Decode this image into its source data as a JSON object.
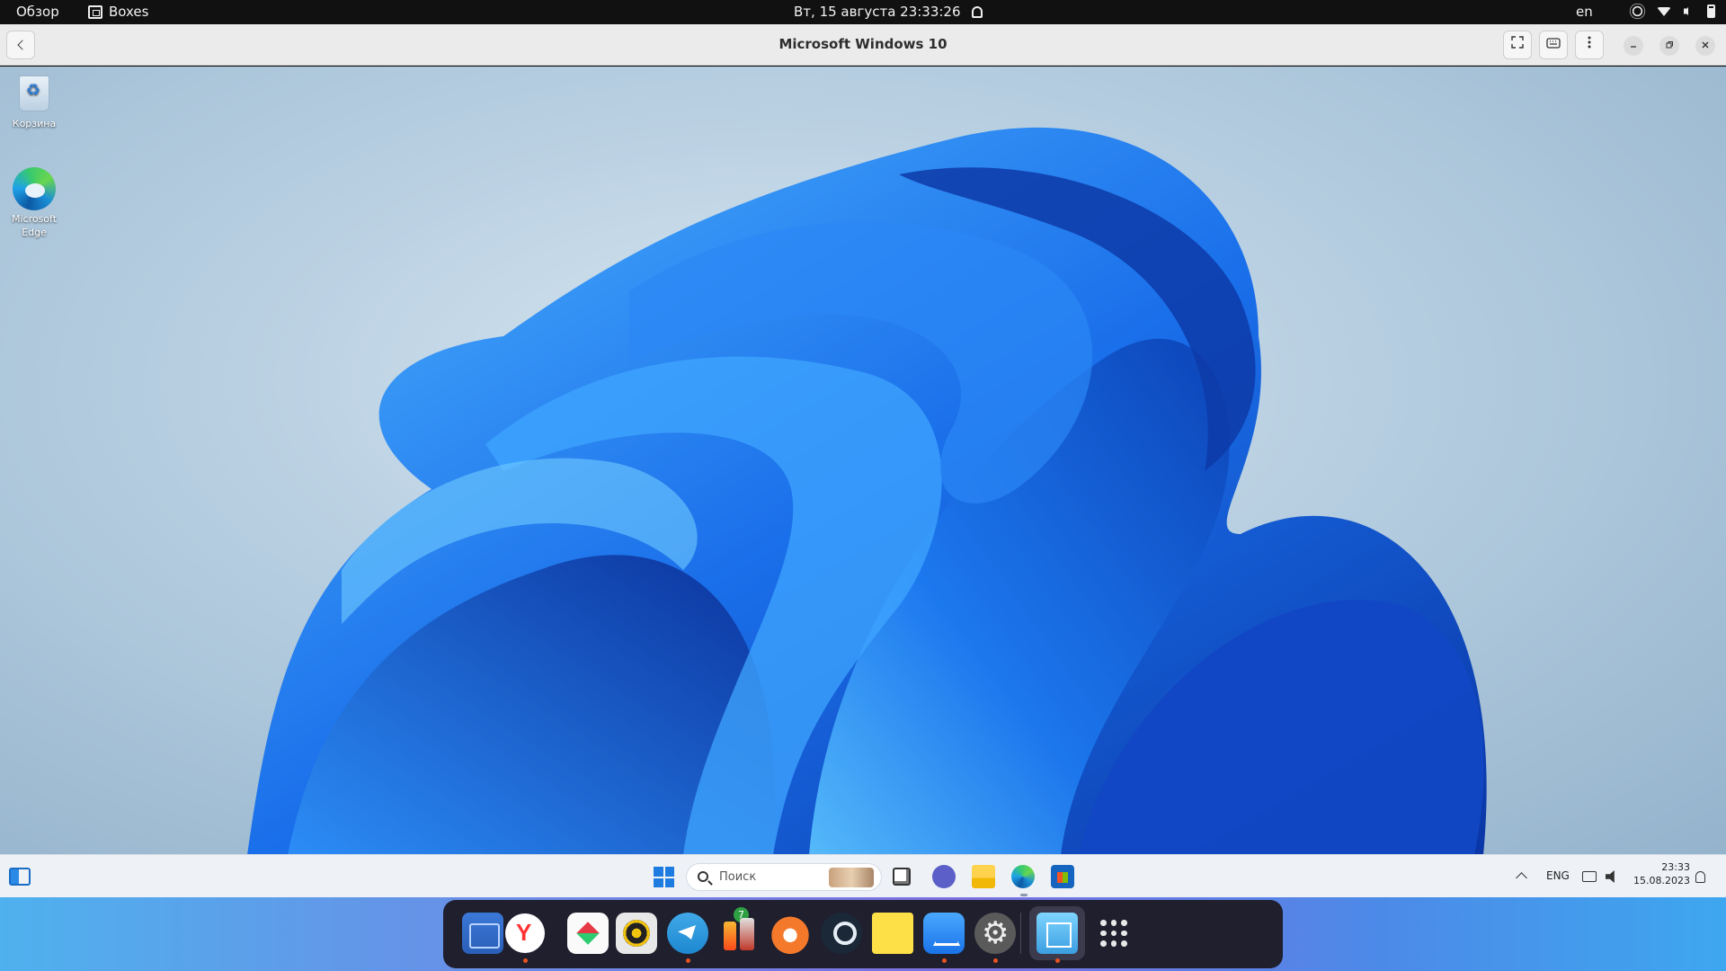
{
  "topbar": {
    "overview": "Обзор",
    "app_name": "Boxes",
    "datetime": "Вт, 15 августа  23:33:26",
    "lang": "en",
    "tray_icons": [
      "brightness-icon",
      "wifi-icon",
      "volume-icon",
      "battery-icon"
    ]
  },
  "headerbar": {
    "title": "Microsoft Windows 10",
    "back_icon": "back-icon",
    "buttons": [
      "fullscreen-icon",
      "keyboard-icon",
      "menu-icon"
    ],
    "window_controls": [
      "minimize",
      "maximize",
      "close"
    ]
  },
  "guest_desktop": {
    "icons": [
      {
        "label": "Корзина",
        "icon": "recycle-bin-icon"
      },
      {
        "label": "Microsoft\nEdge",
        "icon": "edge-icon"
      }
    ]
  },
  "windows_taskbar": {
    "search_placeholder": "Поиск",
    "pinned_apps": [
      "task-view-icon",
      "teams-chat-icon",
      "file-explorer-icon",
      "edge-icon",
      "store-icon"
    ],
    "tray": {
      "lang": "ENG",
      "time": "23:33",
      "date": "15.08.2023"
    }
  },
  "dock": {
    "apps": [
      {
        "name": "files",
        "running": false
      },
      {
        "name": "yandex-browser",
        "running": true
      },
      {
        "name": "anydesk",
        "running": false
      },
      {
        "name": "rhythmbox",
        "running": false
      },
      {
        "name": "telegram",
        "running": true,
        "badge": "7"
      },
      {
        "name": "bottles",
        "running": false
      },
      {
        "name": "blender",
        "running": false
      },
      {
        "name": "steam",
        "running": false
      },
      {
        "name": "sticky-notes",
        "running": false
      },
      {
        "name": "app-center",
        "running": true
      },
      {
        "name": "settings",
        "running": true
      },
      {
        "name": "boxes",
        "running": true
      },
      {
        "name": "show-apps",
        "running": false
      }
    ]
  },
  "colors": {
    "topbar_bg": "#111111",
    "headerbar_bg": "#ebebeb",
    "dock_bg": "#1f1f2e",
    "running_dot": "#e95420",
    "accent_blue": "#1e7ce0"
  }
}
